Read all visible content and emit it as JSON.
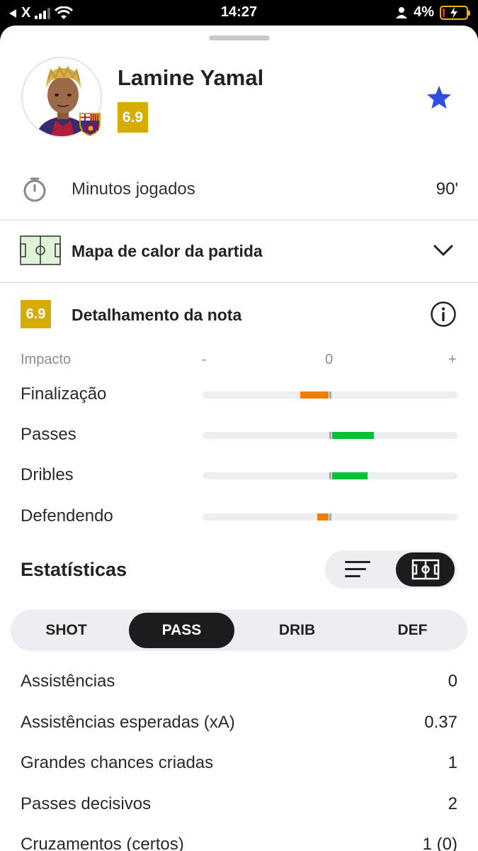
{
  "status_bar": {
    "back_app": "X",
    "time": "14:27",
    "battery": "4%"
  },
  "player": {
    "name": "Lamine Yamal",
    "rating": "6.9"
  },
  "minutes": {
    "label": "Minutos jogados",
    "value": "90'"
  },
  "heatmap": {
    "label": "Mapa de calor da partida"
  },
  "rating_breakdown": {
    "rating": "6.9",
    "label": "Detalhamento da nota"
  },
  "impact": {
    "header": "Impacto",
    "minus": "-",
    "zero": "0",
    "plus": "+",
    "rows": [
      {
        "label": "Finalização",
        "value": -0.22,
        "color": "#f07f00"
      },
      {
        "label": "Passes",
        "value": 0.33,
        "color": "#00c234"
      },
      {
        "label": "Dribles",
        "value": 0.28,
        "color": "#00c234"
      },
      {
        "label": "Defendendo",
        "value": -0.09,
        "color": "#f07f00"
      }
    ]
  },
  "stats": {
    "title": "Estatísticas",
    "tabs": [
      "SHOT",
      "PASS",
      "DRIB",
      "DEF"
    ],
    "active_tab": "PASS",
    "rows": [
      {
        "label": "Assistências",
        "value": "0"
      },
      {
        "label": "Assistências esperadas (xA)",
        "value": "0.37"
      },
      {
        "label": "Grandes chances criadas",
        "value": "1"
      },
      {
        "label": "Passes decisivos",
        "value": "2"
      },
      {
        "label": "Cruzamentos (certos)",
        "value": "1 (0)"
      }
    ]
  },
  "colors": {
    "rating_badge": "#d6ac00",
    "favorite_star": "#2f4fe0",
    "negative_bar": "#f07f00",
    "positive_bar": "#00c234"
  }
}
